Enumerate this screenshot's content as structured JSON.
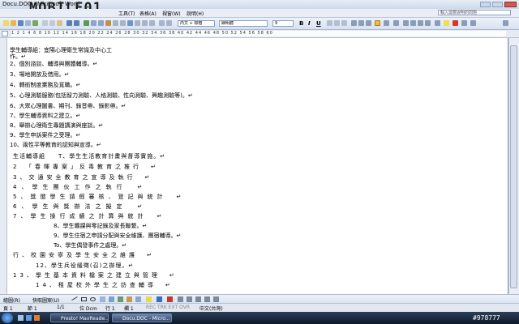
{
  "window": {
    "title": "Docu.DOC - Microsoft Word",
    "watermark_logo": "MOBILE01"
  },
  "menubar": {
    "items": [
      "工具(T)",
      "表格(A)",
      "視窗(W)",
      "說明(H)"
    ],
    "help_placeholder": "輸入需要說明的問題"
  },
  "toolbar": {
    "style_value": "內文 + 標楷",
    "font_value": "細明體",
    "size_value": "9",
    "bold": "B",
    "italic": "I",
    "underline": "U"
  },
  "ruler": {
    "text": "1 2 1 4 6 8 10 12 14 16 18 20 22 24 26 28 30 32 34 36 38 40 42 44 46 48 50 52 54 56 58 60"
  },
  "document": {
    "lines": [
      "學生輔導組：宜陽心理衛生常識及中心工",
      "作。↵",
      "2、個別諮談、輔導與團體輔導。↵",
      "3、場地開放及借用。↵",
      "4、轉銜制度業務及覓職。↵",
      "5、心理測驗服務(包括智力測驗、人格測驗、性向測驗、興趣測驗等)。↵",
      "6、大眾心理圖書、期刊、錄音帶、錄影帶。↵",
      "7、學生輔導資料之建立。↵",
      "8、舉辦心理衛生專題講演與座談。↵",
      "9、學生申訴案件之受理。↵",
      "10、兩性平等教育的認知與宣導。↵",
      "生活輔導組　　T、學生生活教育計畫與督導實施。↵",
      "2　「春暉專案」反毒教育之推行　↵",
      "3、交通安全教育之宣導及執行　↵",
      "4、學生團伙工作之執行　↵",
      "5、獎懲學生請假審核、登記與統計　↵",
      "6、學生與獎辦法之擬定　↵",
      "7、學生操行成績之計算與統計　↵",
      "8、學生曠課與零記錄及家長聯繫。↵",
      "9、學生住宿之申請分配與安全維護、團宿輔導。↵",
      "To、學生偶發事件之處理。↵",
      "行、校園安寧及學生安全之維護　↵",
      "12、學生兵役緩徵(召)之辦理。↵",
      "13、學生基本資料檔案之建立與管理　↵",
      "14、租屋校外學生之訪查輔導　↵"
    ]
  },
  "drawbar": {
    "draw_label": "繪圖(R)",
    "autoshape_label": "快取圖案(U)"
  },
  "statusbar": {
    "page": "頁 1",
    "section": "節 1",
    "pages": "1/1",
    "position": "位 Dcm",
    "line": "行 1",
    "column": "欄 1",
    "flags": "REC TRK EXT OVR",
    "language": "中文(台灣)"
  },
  "taskbar": {
    "tasks": [
      "Presto! MaxReade...",
      "Docu.DOC - Micro..."
    ],
    "watermark_id": "#978777"
  },
  "colors": {
    "accent": "#2b5ea6",
    "page_background": "#ffffff",
    "taskbar": "#1a2940"
  }
}
